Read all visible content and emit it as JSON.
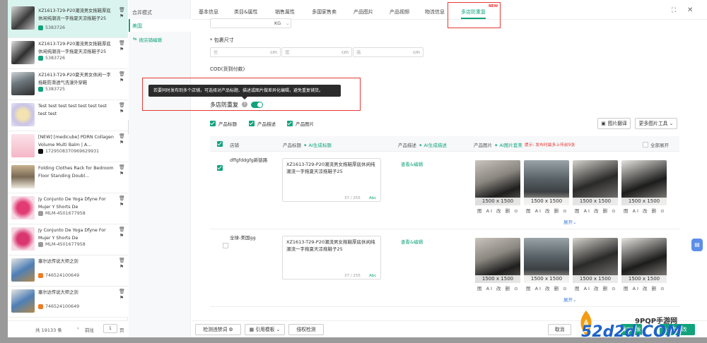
{
  "sidebar": {
    "items": [
      {
        "title": "XZ1613-T29-P20潮流男女拖鞋厚底休闲纯潮流一字拖夏天凉拖鞋子25",
        "meta": "5383726"
      },
      {
        "title": "XZ1613-T29-P20潮流男女拖鞋厚底休闲纯潮流一字拖夏天凉拖鞋子25",
        "meta": "5383726"
      },
      {
        "title": "XZ1613-T29-P20夏天男女休闲一字拖鞋防滑透气洗澡外穿鞋",
        "meta": "5383725"
      },
      {
        "title": "Test test test test test test test test test",
        "meta": ""
      },
      {
        "title": "[NEW] [medicube] PDRN Collagen Volume Multi Balm | A...",
        "meta": "1729508370969629931"
      },
      {
        "title": "Folding Clothes Rack for Bedroom Floor Standing Doubl...",
        "meta": ""
      },
      {
        "title": "Jy Conjunto De Yoga Dfyne For Mujer Y Shorts De",
        "meta": "MLM-4501677958"
      },
      {
        "title": "Jy Conjunto De Yoga Dfyne For Mujer Y Shorts De",
        "meta": "MLM-4501677958"
      },
      {
        "title": "塞尔达传说大师之剑",
        "meta": "746524100649"
      },
      {
        "title": "塞尔达传说大师之剑",
        "meta": "746524100649"
      }
    ],
    "footer": {
      "total": "共 19133 条",
      "prev": "前往",
      "page": "1",
      "suffix": "页"
    }
  },
  "left_menu": {
    "merge_mode": "合并模式",
    "region": "美国",
    "store_edit": "按店铺编辑"
  },
  "tabs": [
    "基本信息",
    "类目&属性",
    "销售属性",
    "多国家售卖",
    "产品图片",
    "产品视频",
    "物流信息",
    "多店防重复"
  ],
  "new_badge": "NEW",
  "form": {
    "kg_unit": "KG",
    "package_size_label": "* 包裹尺寸",
    "length_ph": "长",
    "width_ph": "宽",
    "height_ph": "高",
    "cm": "cm",
    "cod_label": "COD(货到付款)",
    "tooltip": "若要同时发布到多个店铺，可选择对产品标题、描述或图片做差异化编辑，避免重复铺货。",
    "multi_store_label": "多店防重复",
    "toggle_on": true
  },
  "filters": {
    "title": "产品标题",
    "desc": "产品描述",
    "image": "产品图片"
  },
  "top_buttons": {
    "translate": "图片翻译",
    "more_tools": "更多图片工具"
  },
  "table": {
    "col_store": "店铺",
    "col_title": "产品标题",
    "ai_title": "AI生成标题",
    "col_desc": "产品描述",
    "ai_desc": "AI生成描述",
    "col_image": "产品图片",
    "ai_image": "AI图片套美",
    "image_hint": "提示: 发布时最多上传前9张",
    "expand_all": "全部展开",
    "rows": [
      {
        "store": "dffgfddgfg新链路",
        "title": "XZ1613-T29-P20潮流男女拖鞋厚底休闲纯潮流一字拖夏天凉拖鞋子25",
        "count": "37 / 255",
        "abc": "Abc",
        "view": "查看&编辑",
        "checked": true,
        "expand": "展开"
      },
      {
        "store": "全球-美国gg",
        "title": "XZ1613-T29-P20潮流男女拖鞋厚底休闲纯潮流一字拖夏天凉拖鞋子25",
        "count": "37 / 255",
        "abc": "Abc",
        "view": "查看&编辑",
        "checked": false,
        "expand": "展开"
      }
    ],
    "image_size": "1500 x 1500",
    "image_tools": "图 AI 改 删 ⊙"
  },
  "bottom": {
    "check_banned": "检测违禁词",
    "cite_template": "引用模板",
    "infringe_check": "侵权检测",
    "cancel": "取消",
    "save_publish": "保存并发布",
    "save_edit": "保存修改"
  },
  "watermark": {
    "brand": "9PQP手游网",
    "site": "52d2d.COM"
  },
  "colors": {
    "accent": "#12a37c",
    "highlight": "#e53935"
  }
}
